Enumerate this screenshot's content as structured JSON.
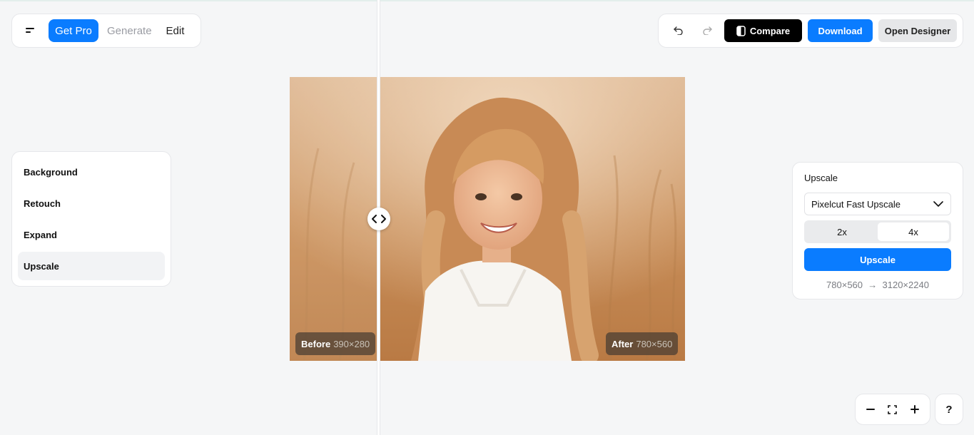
{
  "toolbar_left": {
    "get_pro": "Get Pro",
    "generate": "Generate",
    "edit": "Edit"
  },
  "toolbar_right": {
    "compare": "Compare",
    "download": "Download",
    "open_designer": "Open Designer"
  },
  "tools": {
    "items": [
      "Background",
      "Retouch",
      "Expand",
      "Upscale"
    ],
    "active": "Upscale"
  },
  "canvas": {
    "before_label": "Before",
    "before_dims": "390×280",
    "after_label": "After",
    "after_dims": "780×560"
  },
  "upscale_panel": {
    "title": "Upscale",
    "model": "Pixelcut Fast Upscale",
    "scale_options": [
      "2x",
      "4x"
    ],
    "selected_scale": "4x",
    "button": "Upscale",
    "from_res": "780×560",
    "to_res": "3120×2240"
  },
  "help": "?",
  "colors": {
    "accent": "#0a7cff",
    "compare_bg": "#000000",
    "background": "#f5f6f7"
  }
}
